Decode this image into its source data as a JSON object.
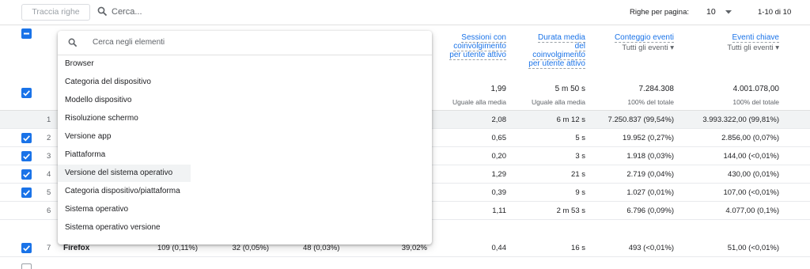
{
  "toolbar": {
    "track_rows": "Traccia righe",
    "search_placeholder": "Cerca...",
    "rows_per_page_label": "Righe per pagina:",
    "rows_per_page_value": "10",
    "range": "1-10 di 10"
  },
  "columns": [
    {
      "label": "Sessioni con coinvolgimento per utente attivo",
      "lines": [
        "Sessioni con",
        "coinvolgimento",
        "per utente attivo"
      ],
      "total": "1,99",
      "total_sub": "Uguale alla media"
    },
    {
      "label": "Durata media del coinvolgimento per utente attivo",
      "lines": [
        "Durata media",
        "del",
        "coinvolgimento",
        "per utente attivo"
      ],
      "total": "5 m 50 s",
      "total_sub": "Uguale alla media"
    },
    {
      "label": "Conteggio eventi",
      "lines": [
        "Conteggio eventi"
      ],
      "sub": "Tutti gli eventi",
      "total": "7.284.308",
      "total_sub": "100% del totale"
    },
    {
      "label": "Eventi chiave",
      "lines": [
        "Eventi chiave"
      ],
      "sub": "Tutti gli eventi",
      "total": "4.001.078,00",
      "total_sub": "100% del totale"
    }
  ],
  "rows": [
    {
      "num": "1",
      "checked": false,
      "grey": true,
      "c1": "2,08",
      "c2": "6 m 12 s",
      "c3": "7.250.837 (99,54%)",
      "c4": "3.993.322,00 (99,81%)"
    },
    {
      "num": "2",
      "checked": true,
      "grey": false,
      "c1": "0,65",
      "c2": "5 s",
      "c3": "19.952 (0,27%)",
      "c4": "2.856,00 (0,07%)"
    },
    {
      "num": "3",
      "checked": true,
      "grey": false,
      "c1": "0,20",
      "c2": "3 s",
      "c3": "1.918 (0,03%)",
      "c4": "144,00 (<0,01%)"
    },
    {
      "num": "4",
      "checked": true,
      "grey": false,
      "c1": "1,29",
      "c2": "21 s",
      "c3": "2.719 (0,04%)",
      "c4": "430,00 (0,01%)"
    },
    {
      "num": "5",
      "checked": true,
      "grey": false,
      "c1": "0,39",
      "c2": "9 s",
      "c3": "1.027 (0,01%)",
      "c4": "107,00 (<0,01%)"
    },
    {
      "num": "6",
      "checked": false,
      "grey": false,
      "c1": "1,11",
      "c2": "2 m 53 s",
      "c3": "6.796 (0,09%)",
      "c4": "4.077,00 (0,1%)"
    },
    {
      "num": "7",
      "checked": true,
      "grey": false,
      "name": "Firefox",
      "a": "109 (0,11%)",
      "b": "32 (0,05%)",
      "c": "48 (0,03%)",
      "d": "39,02%",
      "c1": "0,44",
      "c2": "16 s",
      "c3": "493 (<0,01%)",
      "c4": "51,00 (<0,01%)"
    }
  ],
  "dropdown": {
    "search_placeholder": "Cerca negli elementi",
    "items": [
      "Browser",
      "Categoria del dispositivo",
      "Modello dispositivo",
      "Risoluzione schermo",
      "Versione app",
      "Piattaforma",
      "Versione del sistema operativo",
      "Categoria dispositivo/piattaforma",
      "Sistema operativo",
      "Sistema operativo versione"
    ],
    "highlighted_index": 6
  },
  "colors": {
    "accent": "#1a73e8",
    "row_grey": "#f1f3f4"
  }
}
